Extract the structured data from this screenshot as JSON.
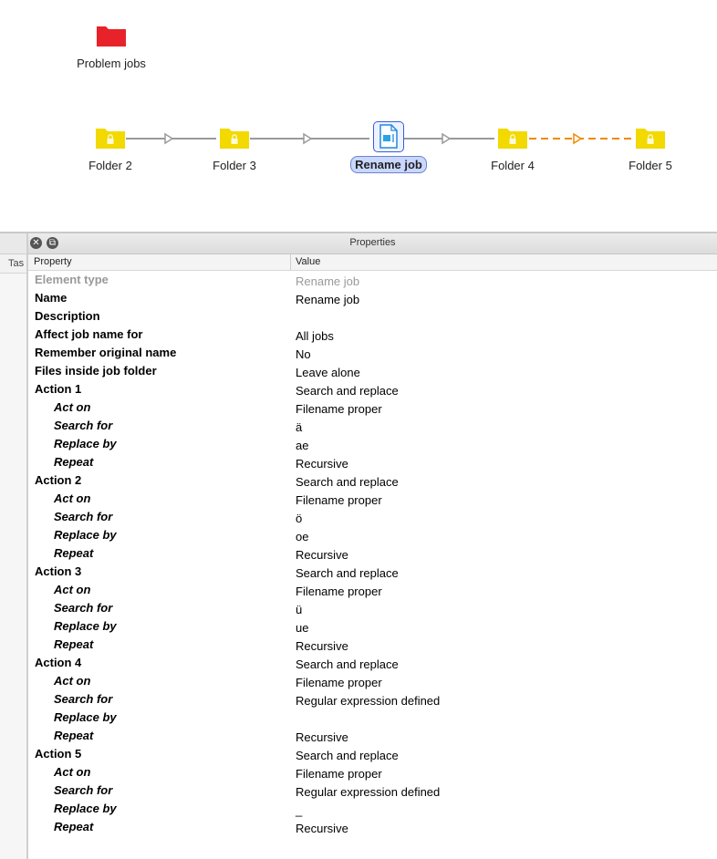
{
  "canvas": {
    "problem_jobs": {
      "label": "Problem jobs",
      "icon": "folder-red-icon",
      "color": "#e8222a"
    },
    "flow_nodes": [
      {
        "label": "Folder 2",
        "icon": "locked-folder-icon"
      },
      {
        "label": "Folder 3",
        "icon": "locked-folder-icon"
      },
      {
        "label": "Rename job",
        "icon": "rename-job-icon",
        "selected": true
      },
      {
        "label": "Folder 4",
        "icon": "locked-folder-icon"
      },
      {
        "label": "Folder 5",
        "icon": "locked-folder-icon"
      }
    ],
    "colors": {
      "folder": "#f2d900",
      "connector": "#9a9a9a",
      "connector_dashed": "#f08a00",
      "selection": "#c9d7ff"
    }
  },
  "left_panel": {
    "tab_label": "Tas"
  },
  "properties_panel": {
    "title": "Properties",
    "columns": {
      "property": "Property",
      "value": "Value"
    },
    "rows": [
      {
        "key": "Element type",
        "value": "Rename job",
        "level": 0,
        "dim": true
      },
      {
        "key": "Name",
        "value": "Rename job",
        "level": 0
      },
      {
        "key": "Description",
        "value": "",
        "level": 0
      },
      {
        "key": "Affect job name for",
        "value": "All jobs",
        "level": 0
      },
      {
        "key": "Remember original name",
        "value": "No",
        "level": 0
      },
      {
        "key": "Files inside job folder",
        "value": "Leave alone",
        "level": 0
      },
      {
        "key": "Action 1",
        "value": "Search and replace",
        "level": 0
      },
      {
        "key": "Act on",
        "value": "Filename proper",
        "level": 1
      },
      {
        "key": "Search for",
        "value": "ä",
        "level": 1
      },
      {
        "key": "Replace by",
        "value": "ae",
        "level": 1
      },
      {
        "key": "Repeat",
        "value": "Recursive",
        "level": 1
      },
      {
        "key": "Action 2",
        "value": "Search and replace",
        "level": 0
      },
      {
        "key": "Act on",
        "value": "Filename proper",
        "level": 1
      },
      {
        "key": "Search for",
        "value": "ö",
        "level": 1
      },
      {
        "key": "Replace by",
        "value": "oe",
        "level": 1
      },
      {
        "key": "Repeat",
        "value": "Recursive",
        "level": 1
      },
      {
        "key": "Action 3",
        "value": "Search and replace",
        "level": 0
      },
      {
        "key": "Act on",
        "value": "Filename proper",
        "level": 1
      },
      {
        "key": "Search for",
        "value": "ü",
        "level": 1
      },
      {
        "key": "Replace by",
        "value": "ue",
        "level": 1
      },
      {
        "key": "Repeat",
        "value": "Recursive",
        "level": 1
      },
      {
        "key": "Action 4",
        "value": "Search and replace",
        "level": 0
      },
      {
        "key": "Act on",
        "value": "Filename proper",
        "level": 1
      },
      {
        "key": "Search for",
        "value": "Regular expression defined",
        "level": 1
      },
      {
        "key": "Replace by",
        "value": "",
        "level": 1
      },
      {
        "key": "Repeat",
        "value": "Recursive",
        "level": 1
      },
      {
        "key": "Action 5",
        "value": "Search and replace",
        "level": 0
      },
      {
        "key": "Act on",
        "value": "Filename proper",
        "level": 1
      },
      {
        "key": "Search for",
        "value": "Regular expression defined",
        "level": 1
      },
      {
        "key": "Replace by",
        "value": "_",
        "level": 1
      },
      {
        "key": "Repeat",
        "value": "Recursive",
        "level": 1
      }
    ]
  }
}
